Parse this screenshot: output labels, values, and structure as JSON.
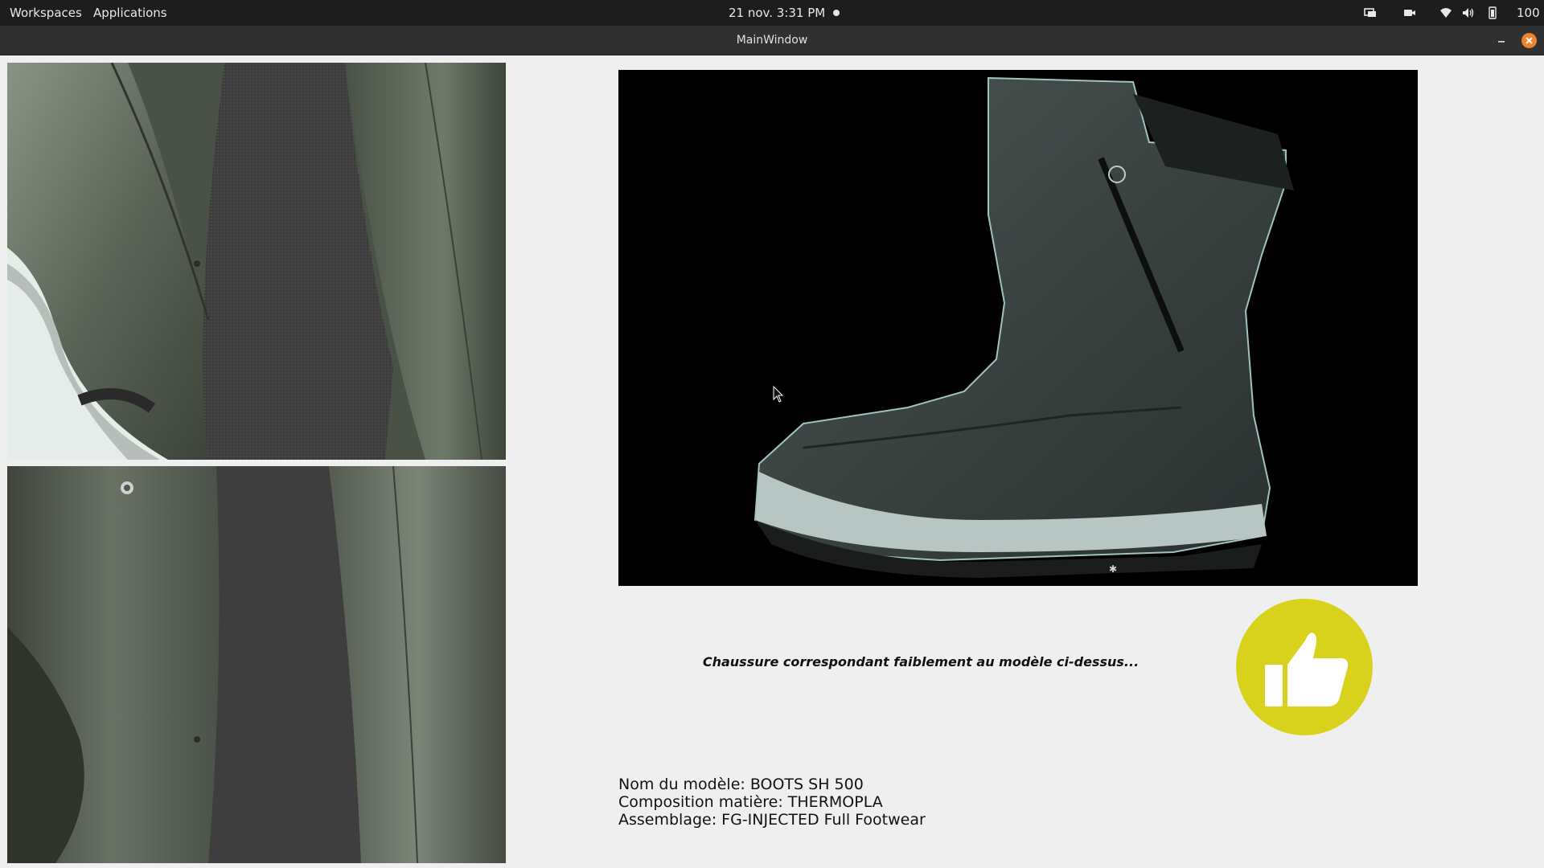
{
  "topbar": {
    "workspaces": "Workspaces",
    "applications": "Applications",
    "clock": "21 nov.  3:31 PM",
    "battery_label": "100 %",
    "icons": [
      "display-icon",
      "camera-icon",
      "wifi-icon",
      "volume-icon",
      "battery-icon"
    ]
  },
  "window": {
    "title": "MainWindow",
    "minimize_icon": "minimize-icon",
    "close_icon": "close-icon"
  },
  "feeds": {
    "top": "camera-feed-top",
    "bottom": "camera-feed-bottom"
  },
  "result": {
    "message": "Chaussure correspondant faiblement au modèle ci-dessus...",
    "badge_icon": "thumbs-up-icon",
    "badge_color": "#d8d21c"
  },
  "model": {
    "name_line": "Nom du modèle: BOOTS SH 500",
    "composition_line": "Composition matière: THERMOPLA",
    "assembly_line": "Assemblage: FG-INJECTED Full Footwear"
  },
  "colors": {
    "topbar": "#1d1d1d",
    "titlebar": "#303030",
    "close_button": "#f0822a",
    "background": "#efefef"
  }
}
